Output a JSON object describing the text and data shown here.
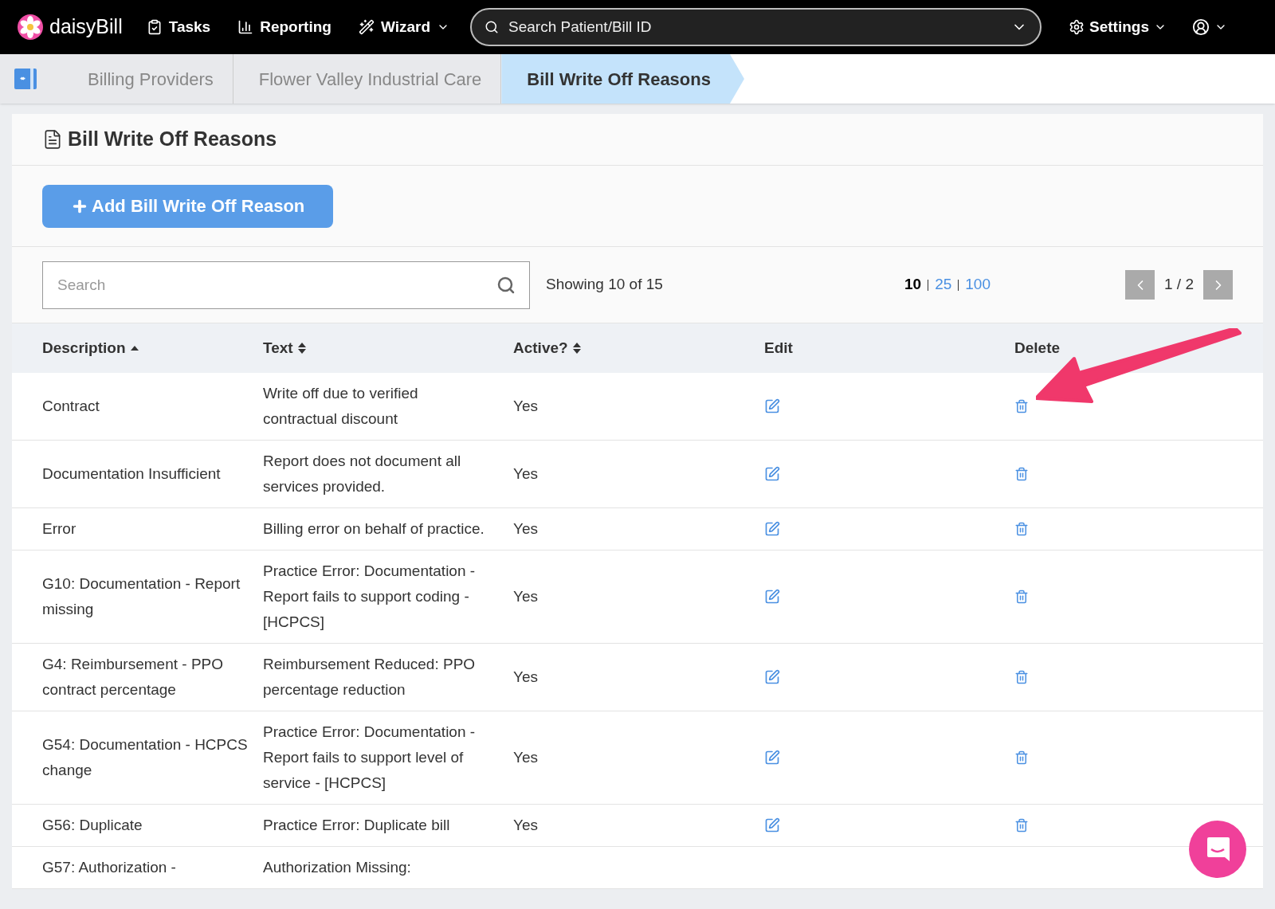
{
  "navbar": {
    "logo": "daisyBill",
    "items": [
      {
        "label": "Tasks",
        "kind": "tasks"
      },
      {
        "label": "Reporting",
        "kind": "reporting"
      },
      {
        "label": "Wizard",
        "kind": "wizard"
      }
    ],
    "search": {
      "placeholder": "Search Patient/Bill ID"
    },
    "settings": "Settings"
  },
  "breadcrumbs": [
    {
      "label": "Billing Providers",
      "selected": false
    },
    {
      "label": "Flower Valley Industrial Care",
      "selected": false
    },
    {
      "label": "Bill Write Off Reasons",
      "selected": true
    }
  ],
  "card": {
    "title": "Bill Write Off Reasons",
    "add_button": "Add Bill Write Off Reason"
  },
  "toolbar": {
    "search": {
      "placeholder": "Search"
    },
    "showing": "Showing 10 of 15",
    "page_sizes": [
      {
        "label": "10",
        "selected": true
      },
      {
        "label": "25",
        "selected": false
      },
      {
        "label": "100",
        "selected": false
      }
    ],
    "page": "1 / 2"
  },
  "table": {
    "columns": [
      {
        "label": "Description",
        "kind": "sorted"
      },
      {
        "label": "Text",
        "kind": "sortable"
      },
      {
        "label": "Active?",
        "kind": "sortable"
      },
      {
        "label": "Edit",
        "kind": "plain"
      },
      {
        "label": "Delete",
        "kind": "plain"
      }
    ],
    "rows": [
      {
        "description": "Contract",
        "text": "Write off due to verified contractual discount",
        "active": "Yes"
      },
      {
        "description": "Documentation Insufficient",
        "text": "Report does not document all services provided.",
        "active": "Yes"
      },
      {
        "description": "Error",
        "text": "Billing error on behalf of practice.",
        "active": "Yes"
      },
      {
        "description": "G10: Documentation - Report missing",
        "text": "Practice Error: Documentation - Report fails to support coding - [HCPCS]",
        "active": "Yes"
      },
      {
        "description": "G4: Reimbursement - PPO contract percentage",
        "text": "Reimbursement Reduced: PPO percentage reduction",
        "active": "Yes"
      },
      {
        "description": "G54: Documentation - HCPCS change",
        "text": "Practice Error: Documentation - Report fails to support level of service - [HCPCS]",
        "active": "Yes"
      },
      {
        "description": "G56: Duplicate",
        "text": "Practice Error: Duplicate bill",
        "active": "Yes"
      },
      {
        "description": "G57: Authorization -",
        "text": "Authorization Missing:"
      }
    ]
  }
}
